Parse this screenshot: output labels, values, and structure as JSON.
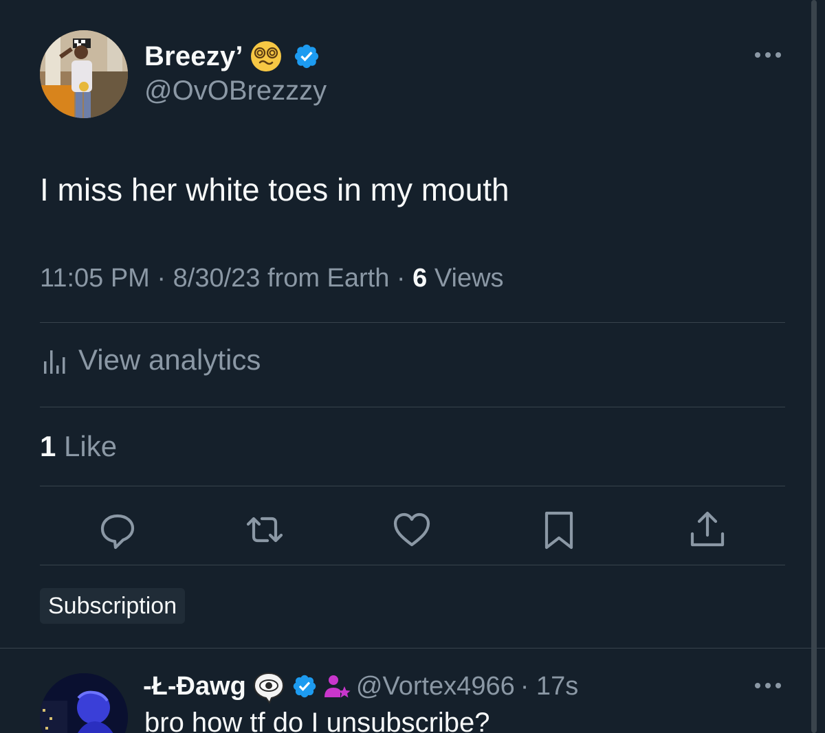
{
  "tweet": {
    "author": {
      "display_name": "Breezy’",
      "name_emoji": "dizzy-face-emoji",
      "verified": true,
      "handle": "@OvOBrezzzy"
    },
    "text": "I miss her white toes in my mouth",
    "meta": {
      "time": "11:05 PM",
      "separator": " · ",
      "date": "8/30/23",
      "source": " from Earth",
      "views_count": "6",
      "views_label": " Views"
    },
    "analytics_label": "View analytics",
    "likes": {
      "count": "1",
      "label": " Like"
    },
    "actions": [
      "reply-icon",
      "retweet-icon",
      "like-icon",
      "bookmark-icon",
      "share-icon"
    ],
    "badge_label": "Subscription"
  },
  "reply": {
    "display_name": "-Ł-Ɖawg",
    "name_emoji": "eye-in-speech-bubble-emoji",
    "verified": true,
    "subscriber_badge": "subscriber-icon",
    "handle": "@Vortex4966",
    "time": " · 17s",
    "text": "bro how tf do I unsubscribe?"
  },
  "colors": {
    "background": "#15202b",
    "primary_text": "#f7f9f9",
    "secondary_text": "#8b98a5",
    "verified_blue": "#1d9bf0",
    "divider": "#38444d",
    "subscriber_purple": "#c936cc"
  }
}
